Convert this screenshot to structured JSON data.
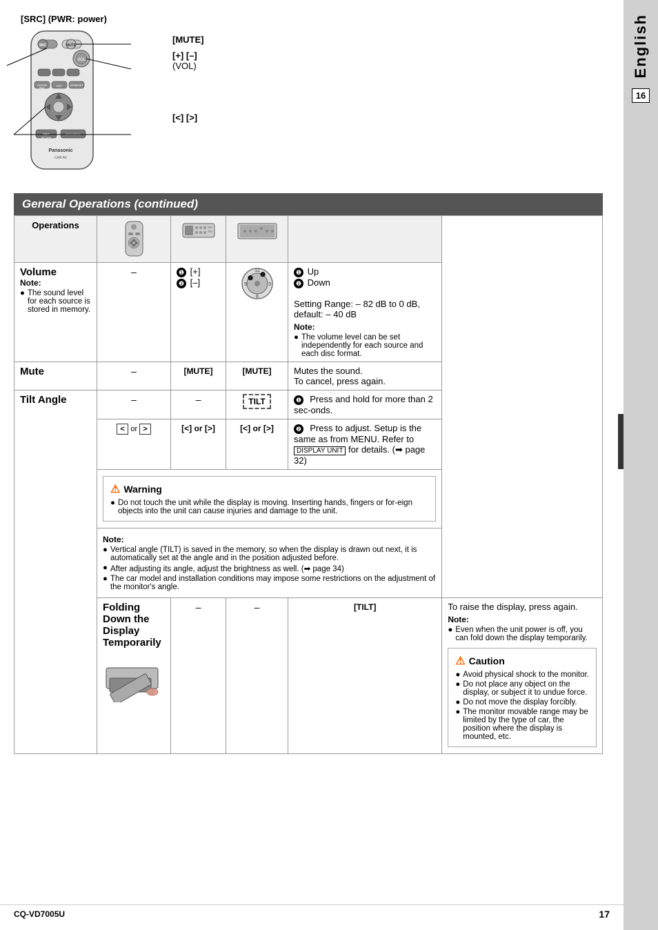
{
  "page": {
    "title": "General Operations (continued)",
    "language": "English",
    "page_numbers": [
      "16",
      "17"
    ],
    "model": "CQ-VD7005U"
  },
  "top": {
    "src_label": "[SRC] (PWR: power)",
    "mute_label": "[MUTE]",
    "vol_label": "[+] [–]",
    "vol_sublabel": "(VOL)",
    "nav_label": "[<] [>]"
  },
  "table": {
    "header": "General Operations (continued)",
    "col_ops": "Operations",
    "rows": [
      {
        "name": "Volume",
        "note_label": "Note:",
        "note_bullets": [
          "The sound level for each source is stored in memory."
        ],
        "remote": "–",
        "unit": "❶ [+]\n❷ [–]",
        "monitor": "(dial icon)",
        "desc": "❶ Up\n❷ Down",
        "extra": "Setting Range: – 82 dB to 0 dB,  default: – 40 dB",
        "extra_note": "Note:",
        "extra_note_bullets": [
          "The volume level can be set independently for each source and each disc format."
        ]
      },
      {
        "name": "Mute",
        "remote": "–",
        "unit": "[MUTE]",
        "monitor": "[MUTE]",
        "desc": "Mutes the sound.\nTo cancel, press again."
      },
      {
        "name": "Tilt Angle",
        "rows": [
          {
            "remote": "–",
            "unit": "–",
            "monitor": "[TILT]",
            "desc": "❶  Press and hold for more than 2 sec-onds."
          },
          {
            "remote": "< or >",
            "unit": "[<] or [>]",
            "monitor": "[<] or [>]",
            "desc": "❷  Press to adjust. Setup is the same as from MENU. Refer to DISPLAY UNIT for details. (➡ page 32)"
          }
        ],
        "warning": {
          "title": "Warning",
          "bullets": [
            "Do not touch the unit while the display is moving. Inserting hands, fingers or for-eign objects into the unit can cause injuries and damage to the unit."
          ]
        },
        "note": {
          "label": "Note:",
          "bullets": [
            "Vertical angle (TILT) is saved in the memory, so when the display is drawn out next, it is automatically set at the angle and in the position adjusted before.",
            "After adjusting its angle, adjust the brightness as well. (➡ page 34)",
            "The car model and installation conditions may impose some restrictions on the adjustment of the monitor's angle."
          ]
        }
      },
      {
        "name": "Folding Down the Display Temporarily",
        "remote": "–",
        "unit": "–",
        "monitor": "[TILT]",
        "desc": "To raise the display, press again.",
        "note": {
          "label": "Note:",
          "bullets": [
            "Even when the unit power is off, you can fold down the display temporarily."
          ]
        },
        "caution": {
          "title": "Caution",
          "bullets": [
            "Avoid physical shock to the monitor.",
            "Do not place any object on the display, or subject it to undue force.",
            "Do not move the display forcibly.",
            "The monitor movable range may be limited by the type of car, the position where the display is mounted, etc."
          ]
        }
      }
    ]
  }
}
